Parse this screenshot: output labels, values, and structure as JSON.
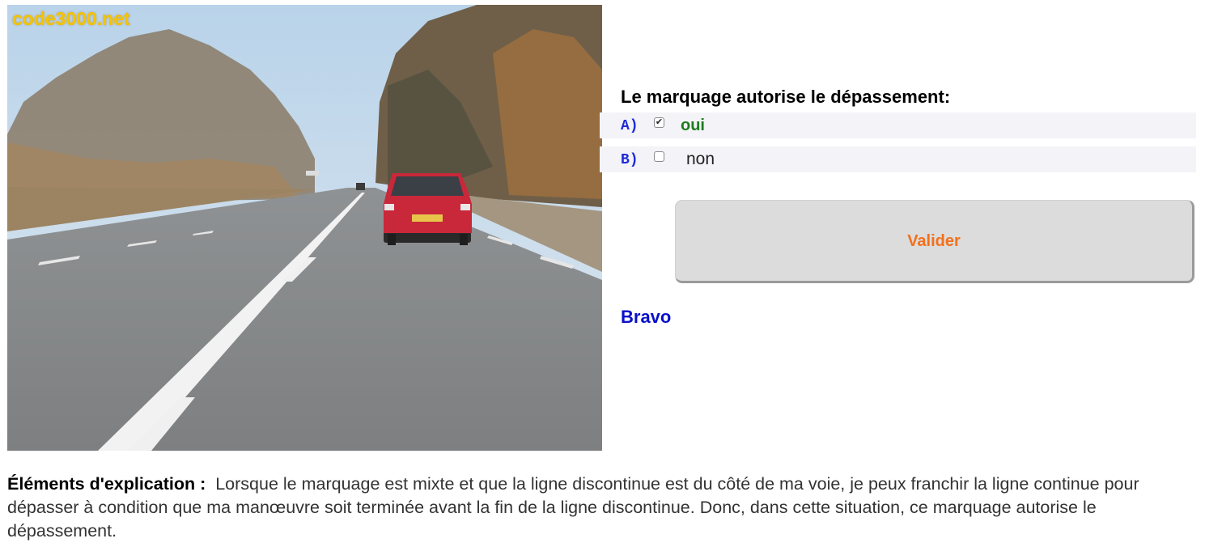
{
  "photo": {
    "watermark": "code3000.net",
    "plate_text": "▬▬▬▬"
  },
  "question": {
    "text": "Le marquage autorise le dépassement:"
  },
  "options": [
    {
      "letter": "A)",
      "label": "oui",
      "checked": true,
      "check_mark": "✔"
    },
    {
      "letter": "B)",
      "label": "non",
      "checked": false,
      "check_mark": ""
    }
  ],
  "validate_button": {
    "label": "Valider"
  },
  "result": {
    "text": "Bravo"
  },
  "explanation": {
    "title": "Éléments d'explication :",
    "body": "Lorsque le marquage est mixte et que la ligne discontinue est du côté de ma voie, je peux franchir la ligne continue pour dépasser à condition que ma manœuvre soit terminée avant la fin de la ligne discontinue. Donc, dans cette situation, ce marquage autorise le dépassement."
  },
  "colors": {
    "answer_correct": "#1f7a1f",
    "option_letter": "#1f2bd6",
    "button_text": "#f2701c",
    "result_text": "#0a10c9",
    "watermark": "#f5c400"
  }
}
